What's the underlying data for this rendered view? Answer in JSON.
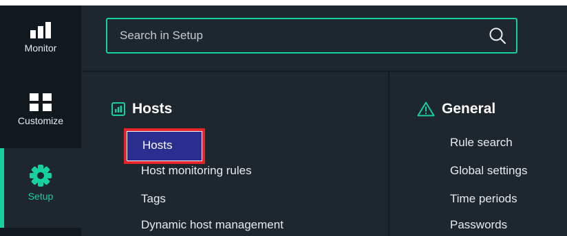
{
  "sidebar": {
    "items": [
      {
        "label": "Monitor",
        "icon": "bar-chart-icon"
      },
      {
        "label": "Customize",
        "icon": "grid-icon"
      },
      {
        "label": "Setup",
        "icon": "gear-icon",
        "active": true
      }
    ]
  },
  "search": {
    "placeholder": "Search in Setup",
    "value": ""
  },
  "sections": {
    "hosts": {
      "title": "Hosts",
      "links": [
        "Hosts",
        "Host monitoring rules",
        "Tags",
        "Dynamic host management"
      ]
    },
    "general": {
      "title": "General",
      "links": [
        "Rule search",
        "Global settings",
        "Time periods",
        "Passwords"
      ]
    }
  },
  "colors": {
    "accent": "#15d1a0",
    "sidebar_bg": "#11191f",
    "panel_bg": "#1e272e",
    "highlight": "#2b2e8e",
    "highlight_border": "#e5252b"
  }
}
